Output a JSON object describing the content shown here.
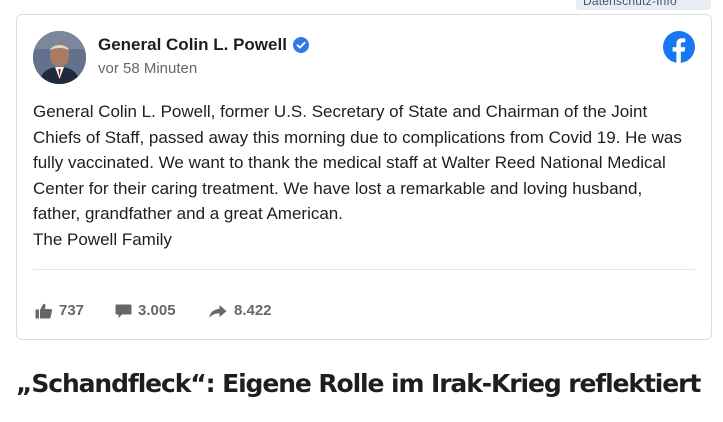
{
  "privacy_tab": {
    "label": "Datenschutz-Info"
  },
  "post": {
    "author": "General Colin L. Powell",
    "timestamp": "vor 58 Minuten",
    "paragraph": "General Colin L. Powell, former U.S. Secretary of State and Chairman of the Joint Chiefs of Staff, passed away this morning due to complications from Covid 19. He was fully vaccinated. We want to thank the medical staff at Walter Reed National Medical Center for their caring treatment. We have lost a remarkable and loving husband, father, grandfather and a great American.",
    "signature": "The Powell Family",
    "likes": "737",
    "comments": "3.005",
    "shares": "8.422"
  },
  "article": {
    "headline": "„Schandfleck“: Eigene Rolle im Irak-Krieg reflektiert"
  },
  "colors": {
    "facebook_blue": "#1877f2",
    "verified_blue": "#3578e5",
    "muted_gray": "#65676b"
  },
  "icons": [
    "verified-badge-icon",
    "facebook-logo-icon",
    "like-icon",
    "comment-icon",
    "share-icon"
  ]
}
